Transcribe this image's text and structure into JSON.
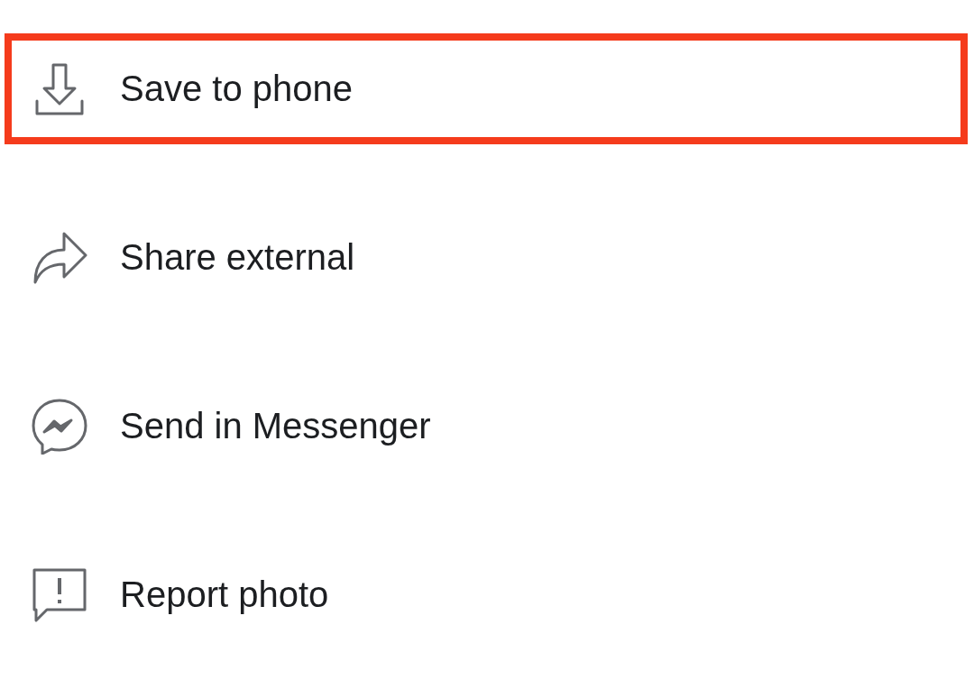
{
  "menu": {
    "items": [
      {
        "kind": "download",
        "label": "Save to phone",
        "highlighted": true
      },
      {
        "kind": "share",
        "label": "Share external",
        "highlighted": false
      },
      {
        "kind": "messenger",
        "label": "Send in Messenger",
        "highlighted": false
      },
      {
        "kind": "report",
        "label": "Report photo",
        "highlighted": false
      }
    ]
  }
}
